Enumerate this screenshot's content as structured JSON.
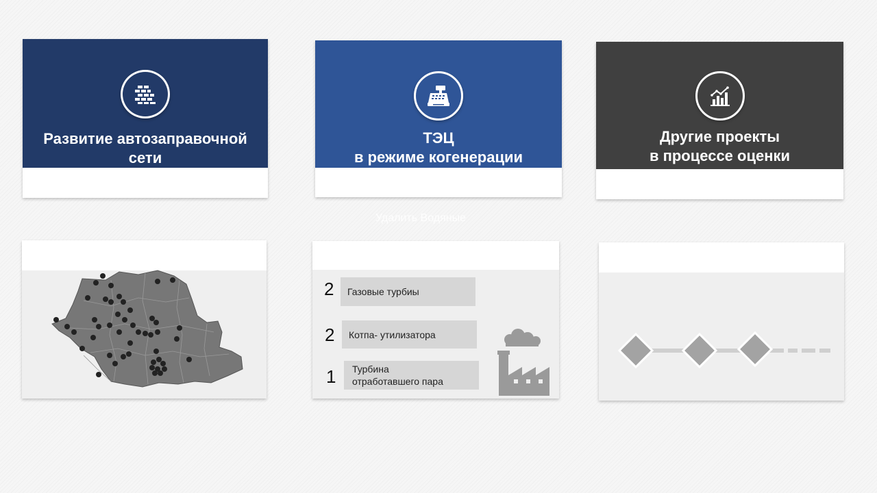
{
  "cards": [
    {
      "title_lines": [
        "Развитие автозаправочной",
        "сети"
      ],
      "icon": "bricks-icon",
      "color": "#223a68"
    },
    {
      "title_lines": [
        "ТЭЦ",
        "в режиме когенерации"
      ],
      "icon": "cash-register-icon",
      "color": "#2f5597"
    },
    {
      "title_lines": [
        "Другие проекты",
        "в процессе оценки"
      ],
      "icon": "bar-chart-icon",
      "color": "#404040"
    }
  ],
  "watermark": "Удалить   Водяные",
  "equipment": [
    {
      "count": "2",
      "label_lines": [
        "Газовые  турбиы"
      ]
    },
    {
      "count": "2",
      "label_lines": [
        "Котпа-  утилизатора"
      ]
    },
    {
      "count": "1",
      "label_lines": [
        "Турбина",
        "отработавшего пара"
      ]
    }
  ],
  "map_icon": "romania-map-icon",
  "factory_icon": "factory-icon",
  "timeline_icon": "timeline-diamonds-icon"
}
